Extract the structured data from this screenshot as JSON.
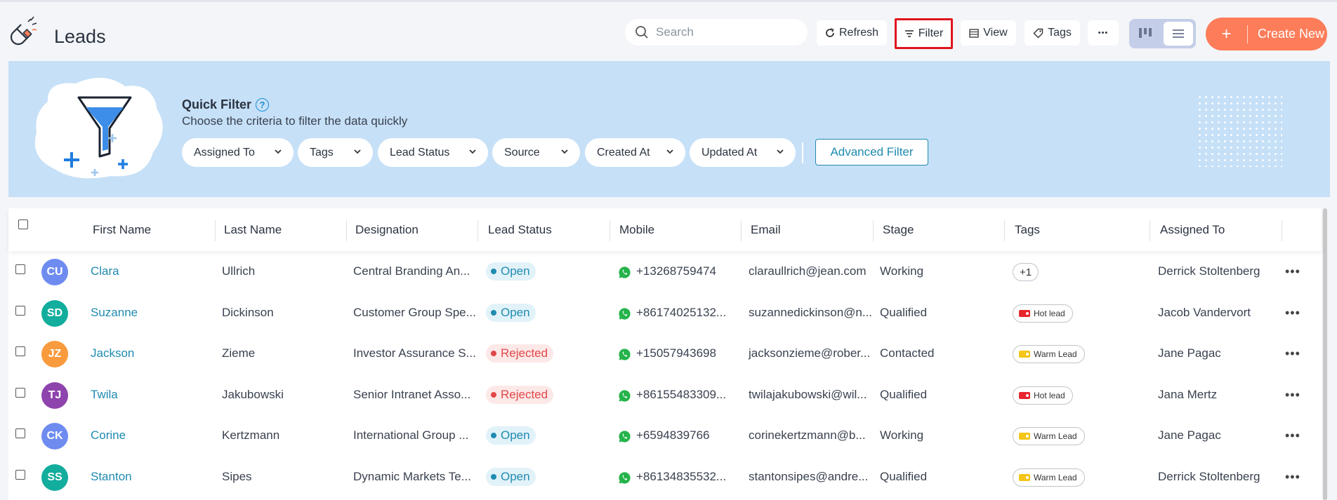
{
  "header": {
    "title": "Leads",
    "search_placeholder": "Search",
    "refresh_label": "Refresh",
    "filter_label": "Filter",
    "view_label": "View",
    "tags_label": "Tags",
    "more_label": "•••",
    "create_label": "Create New"
  },
  "quick_filter": {
    "title": "Quick Filter",
    "subtitle": "Choose the criteria to filter the data quickly",
    "pills": [
      "Assigned To",
      "Tags",
      "Lead Status",
      "Source",
      "Created At",
      "Updated At"
    ],
    "advanced_label": "Advanced Filter"
  },
  "table": {
    "columns": [
      "First Name",
      "Last Name",
      "Designation",
      "Lead Status",
      "Mobile",
      "Email",
      "Stage",
      "Tags",
      "Assigned To"
    ],
    "rows": [
      {
        "initials": "CU",
        "avatar_color": "#6e8cf0",
        "first": "Clara",
        "last": "Ullrich",
        "designation": "Central Branding An...",
        "status": "Open",
        "mobile": "+13268759474",
        "email": "claraullrich@jean.com",
        "stage": "Working",
        "tag": "+1",
        "tag_type": "count",
        "assigned": "Derrick Stoltenberg"
      },
      {
        "initials": "SD",
        "avatar_color": "#12ad9d",
        "first": "Suzanne",
        "last": "Dickinson",
        "designation": "Customer Group Spe...",
        "status": "Open",
        "mobile": "+86174025132...",
        "email": "suzannedickinson@n...",
        "stage": "Qualified",
        "tag": "Hot lead",
        "tag_type": "hot",
        "assigned": "Jacob Vandervort"
      },
      {
        "initials": "JZ",
        "avatar_color": "#f99a3d",
        "first": "Jackson",
        "last": "Zieme",
        "designation": "Investor Assurance S...",
        "status": "Rejected",
        "mobile": "+15057943698",
        "email": "jacksonzieme@rober...",
        "stage": "Contacted",
        "tag": "Warm Lead",
        "tag_type": "warm",
        "assigned": "Jane Pagac"
      },
      {
        "initials": "TJ",
        "avatar_color": "#8e44ad",
        "first": "Twila",
        "last": "Jakubowski",
        "designation": "Senior Intranet Asso...",
        "status": "Rejected",
        "mobile": "+86155483309...",
        "email": "twilajakubowski@wil...",
        "stage": "Qualified",
        "tag": "Hot lead",
        "tag_type": "hot",
        "assigned": "Jana Mertz"
      },
      {
        "initials": "CK",
        "avatar_color": "#6e8cf0",
        "first": "Corine",
        "last": "Kertzmann",
        "designation": "International Group ...",
        "status": "Open",
        "mobile": "+6594839766",
        "email": "corinekertzmann@b...",
        "stage": "Working",
        "tag": "Warm Lead",
        "tag_type": "warm",
        "assigned": "Jane Pagac"
      },
      {
        "initials": "SS",
        "avatar_color": "#12ad9d",
        "first": "Stanton",
        "last": "Sipes",
        "designation": "Dynamic Markets Te...",
        "status": "Open",
        "mobile": "+86134835532...",
        "email": "stantonsipes@andre...",
        "stage": "Qualified",
        "tag": "Warm Lead",
        "tag_type": "warm",
        "assigned": "Derrick Stoltenberg"
      }
    ]
  },
  "colors": {
    "accent": "#1f8bb0",
    "create_button": "#fd7d5a",
    "banner": "#c6e0f7",
    "filter_highlight": "#e0141e",
    "hot_tag": "#e8262e",
    "warm_tag": "#f5c518"
  },
  "icons": {
    "logo": "magnet-icon",
    "search": "search-icon",
    "refresh": "refresh-icon",
    "filter": "filter-icon",
    "view": "view-columns-icon",
    "tags": "tag-icon",
    "kanban": "kanban-icon",
    "list": "list-icon",
    "whatsapp": "whatsapp-icon"
  }
}
